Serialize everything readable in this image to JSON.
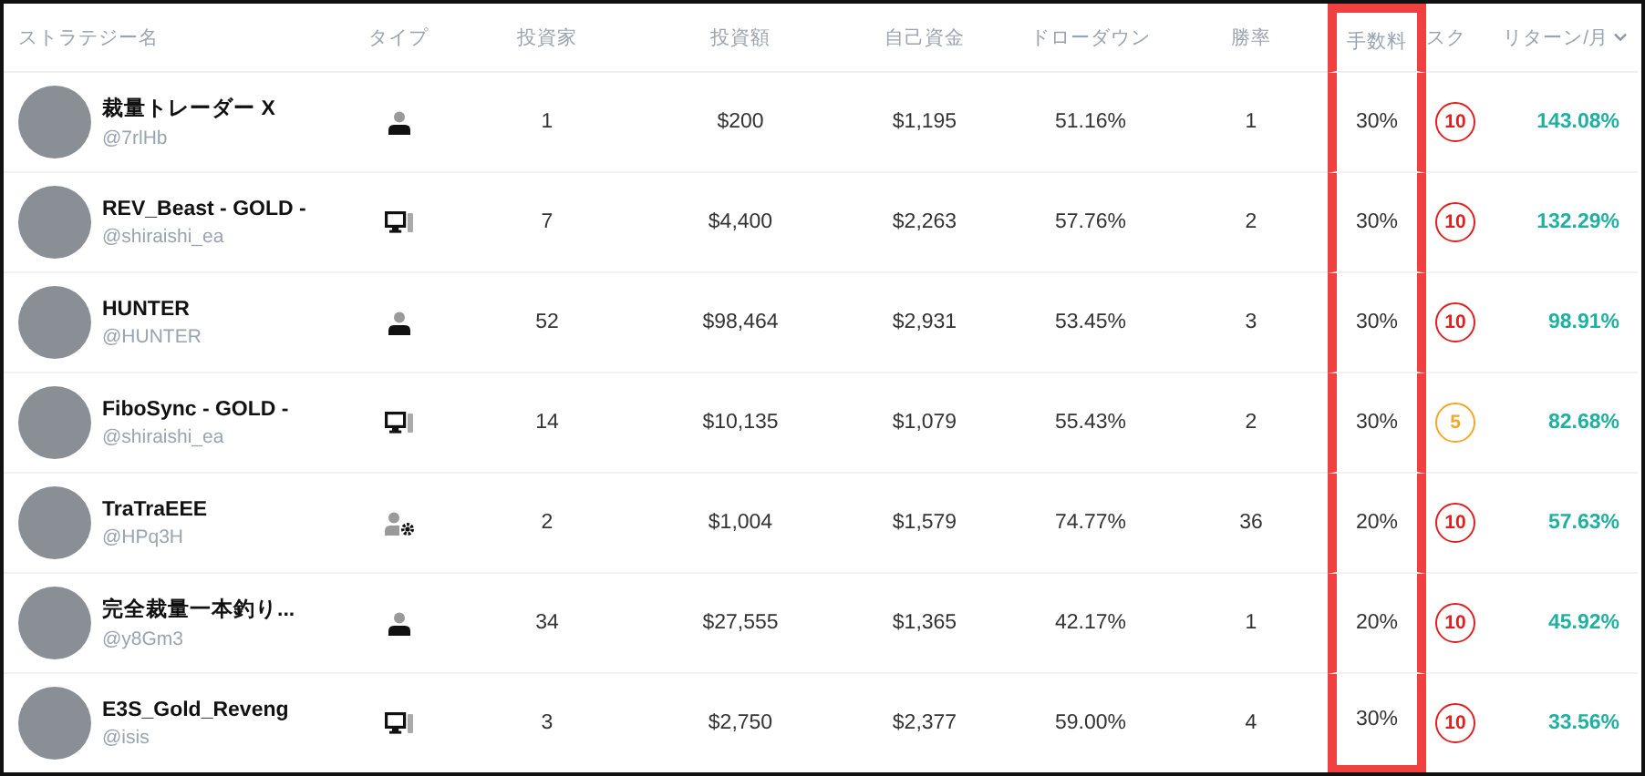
{
  "columns": [
    {
      "label": "ストラテジー名",
      "highlighted": false,
      "sorted": false
    },
    {
      "label": "タイプ",
      "highlighted": false,
      "sorted": false
    },
    {
      "label": "投資家",
      "highlighted": false,
      "sorted": false
    },
    {
      "label": "投資額",
      "highlighted": false,
      "sorted": false
    },
    {
      "label": "自己資金",
      "highlighted": false,
      "sorted": false
    },
    {
      "label": "ドローダウン",
      "highlighted": false,
      "sorted": false
    },
    {
      "label": "勝率",
      "highlighted": false,
      "sorted": false
    },
    {
      "label": "手数料",
      "highlighted": true,
      "sorted": false
    },
    {
      "label": "スク",
      "highlighted": false,
      "sorted": false
    },
    {
      "label": "リターン/月",
      "highlighted": false,
      "sorted": true
    }
  ],
  "rows": [
    {
      "name": "裁量トレーダー X",
      "handle": "@7rlHb",
      "kind": "person",
      "investors": "1",
      "amount": "$200",
      "capital": "$1,195",
      "drawdown": "51.16%",
      "win_rate": "1",
      "fee": "30%",
      "risk": {
        "value": "10",
        "color": "#e02020"
      },
      "return": "143.08%"
    },
    {
      "name": "REV_Beast - GOLD -",
      "handle": "@shiraishi_ea",
      "kind": "desktop",
      "investors": "7",
      "amount": "$4,400",
      "capital": "$2,263",
      "drawdown": "57.76%",
      "win_rate": "2",
      "fee": "30%",
      "risk": {
        "value": "10",
        "color": "#e02020"
      },
      "return": "132.29%"
    },
    {
      "name": "HUNTER",
      "handle": "@HUNTER",
      "kind": "person",
      "investors": "52",
      "amount": "$98,464",
      "capital": "$2,931",
      "drawdown": "53.45%",
      "win_rate": "3",
      "fee": "30%",
      "risk": {
        "value": "10",
        "color": "#e02020"
      },
      "return": "98.91%"
    },
    {
      "name": "FiboSync - GOLD -",
      "handle": "@shiraishi_ea",
      "kind": "desktop",
      "investors": "14",
      "amount": "$10,135",
      "capital": "$1,079",
      "drawdown": "55.43%",
      "win_rate": "2",
      "fee": "30%",
      "risk": {
        "value": "5",
        "color": "#f5a623"
      },
      "return": "82.68%"
    },
    {
      "name": "TraTraEEE",
      "handle": "@HPq3H",
      "kind": "team",
      "investors": "2",
      "amount": "$1,004",
      "capital": "$1,579",
      "drawdown": "74.77%",
      "win_rate": "36",
      "fee": "20%",
      "risk": {
        "value": "10",
        "color": "#e02020"
      },
      "return": "57.63%"
    },
    {
      "name": "完全裁量一本釣り...",
      "handle": "@y8Gm3",
      "kind": "person",
      "investors": "34",
      "amount": "$27,555",
      "capital": "$1,365",
      "drawdown": "42.17%",
      "win_rate": "1",
      "fee": "20%",
      "risk": {
        "value": "10",
        "color": "#e02020"
      },
      "return": "45.92%"
    },
    {
      "name": "E3S_Gold_Reveng",
      "handle": "@isis",
      "kind": "desktop",
      "investors": "3",
      "amount": "$2,750",
      "capital": "$2,377",
      "drawdown": "59.00%",
      "win_rate": "4",
      "fee": "30%",
      "risk": {
        "value": "10",
        "color": "#e02020"
      },
      "return": "33.56%"
    }
  ]
}
